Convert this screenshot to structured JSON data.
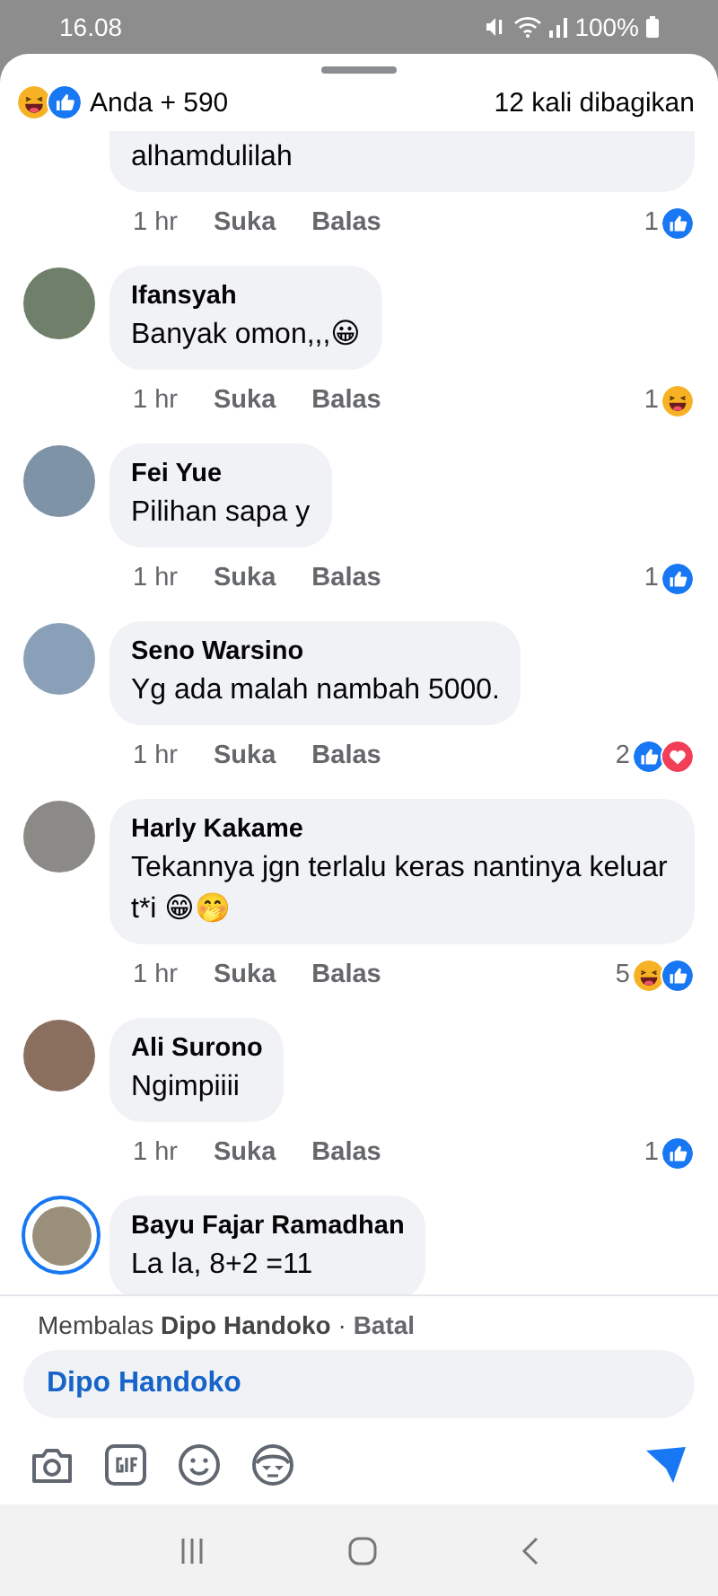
{
  "status_bar": {
    "time": "16.08",
    "battery": "100%"
  },
  "summary": {
    "reactions": [
      {
        "kind": "haha"
      },
      {
        "kind": "like"
      }
    ],
    "label": "Anda + 590",
    "shares": "12 kali dibagikan"
  },
  "comments": [
    {
      "text": "alhamdulilah",
      "time": "1 hr",
      "like": "Suka",
      "reply": "Balas",
      "count": "1",
      "reactions": [
        {
          "kind": "like"
        }
      ]
    },
    {
      "author": "Ifansyah",
      "has_story": false,
      "text": "Banyak omon,,,😀",
      "time": "1 hr",
      "like": "Suka",
      "reply": "Balas",
      "count": "1",
      "reactions": [
        {
          "kind": "haha"
        }
      ]
    },
    {
      "author": "Fei Yue",
      "has_story": false,
      "text": "Pilihan sapa y",
      "time": "1 hr",
      "like": "Suka",
      "reply": "Balas",
      "count": "1",
      "reactions": [
        {
          "kind": "like"
        }
      ]
    },
    {
      "author": "Seno Warsino",
      "has_story": false,
      "text": "Yg ada malah nambah 5000.",
      "time": "1 hr",
      "like": "Suka",
      "reply": "Balas",
      "count": "2",
      "reactions": [
        {
          "kind": "like"
        },
        {
          "kind": "love"
        }
      ]
    },
    {
      "author": "Harly Kakame",
      "has_story": false,
      "text": "Tekannya jgn terlalu keras nantinya keluar t*i 😁🤭",
      "time": "1 hr",
      "like": "Suka",
      "reply": "Balas",
      "count": "5",
      "reactions": [
        {
          "kind": "haha"
        },
        {
          "kind": "like"
        }
      ]
    },
    {
      "author": "Ali Surono",
      "has_story": false,
      "text": "Ngimpiiii",
      "time": "1 hr",
      "like": "Suka",
      "reply": "Balas",
      "count": "1",
      "reactions": [
        {
          "kind": "like"
        }
      ]
    },
    {
      "author": "Bayu Fajar Ramadhan",
      "has_story": true,
      "text": "La la,  8+2 =11"
    }
  ],
  "reply_bar": {
    "prefix": "Membalas",
    "name": "Dipo Handoko",
    "separator": "·",
    "cancel": "Batal",
    "value": "Dipo Handoko"
  }
}
